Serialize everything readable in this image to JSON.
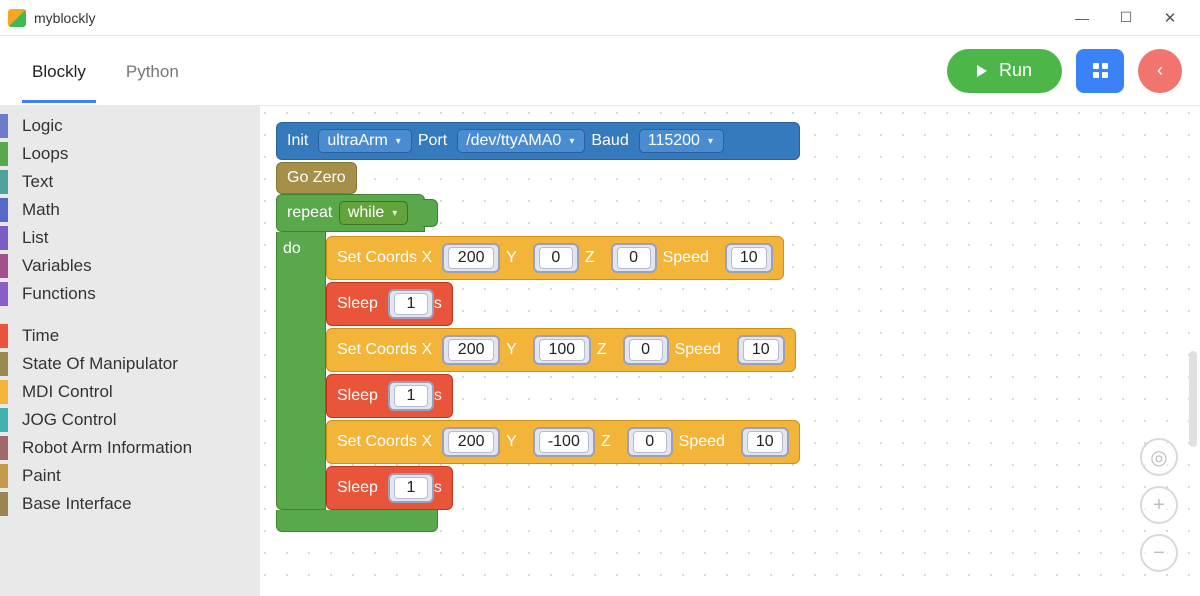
{
  "window": {
    "title": "myblockly"
  },
  "tabs": {
    "blockly": "Blockly",
    "python": "Python"
  },
  "buttons": {
    "run": "Run"
  },
  "sidebar": {
    "groupA": [
      {
        "label": "Logic",
        "color": "#6b7dc9"
      },
      {
        "label": "Loops",
        "color": "#59a84c"
      },
      {
        "label": "Text",
        "color": "#4fa39a"
      },
      {
        "label": "Math",
        "color": "#5868c8"
      },
      {
        "label": "List",
        "color": "#7b5ec5"
      },
      {
        "label": "Variables",
        "color": "#a3518c"
      },
      {
        "label": "Functions",
        "color": "#8b5ec5"
      }
    ],
    "groupB": [
      {
        "label": "Time",
        "color": "#e9553a"
      },
      {
        "label": "State Of Manipulator",
        "color": "#9a8a4f"
      },
      {
        "label": "MDI Control",
        "color": "#f3b43a"
      },
      {
        "label": "JOG Control",
        "color": "#44b1b1"
      },
      {
        "label": "Robot Arm Information",
        "color": "#a16a6a"
      },
      {
        "label": "Paint",
        "color": "#c59a4a"
      },
      {
        "label": "Base Interface",
        "color": "#9a8550"
      }
    ]
  },
  "blocks": {
    "init": {
      "label_init": "Init",
      "device": "ultraArm",
      "label_port": "Port",
      "port": "/dev/ttyAMA0",
      "label_baud": "Baud",
      "baud": "115200"
    },
    "gozero": "Go Zero",
    "repeat": {
      "label": "repeat",
      "mode": "while",
      "do": "do"
    },
    "coords": {
      "label": "Set Coords X",
      "y": "Y",
      "z": "Z",
      "speed": "Speed",
      "rows": [
        {
          "x": "200",
          "y": "0",
          "z": "0",
          "speed": "10"
        },
        {
          "x": "200",
          "y": "100",
          "z": "0",
          "speed": "10"
        },
        {
          "x": "200",
          "y": "-100",
          "z": "0",
          "speed": "10"
        }
      ]
    },
    "sleep": {
      "label": "Sleep",
      "unit": "s",
      "values": [
        "1",
        "1",
        "1"
      ]
    }
  }
}
